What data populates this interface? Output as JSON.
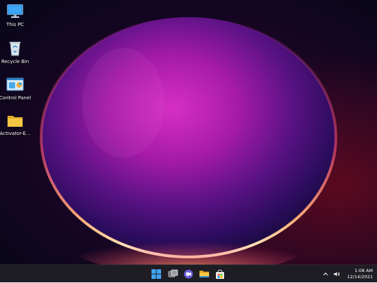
{
  "desktop": {
    "icons": [
      {
        "label": "This PC",
        "icon": "this-pc-icon"
      },
      {
        "label": "Recycle Bin",
        "icon": "recycle-bin-icon"
      },
      {
        "label": "Control Panel",
        "icon": "control-panel-icon"
      },
      {
        "label": "Activator-E...",
        "icon": "folder-icon"
      }
    ]
  },
  "taskbar": {
    "apps": [
      {
        "name": "Start",
        "icon": "windows-start-icon"
      },
      {
        "name": "Task View",
        "icon": "task-view-icon"
      },
      {
        "name": "Chat",
        "icon": "chat-icon"
      },
      {
        "name": "File Explorer",
        "icon": "file-explorer-icon"
      },
      {
        "name": "Microsoft Store",
        "icon": "store-icon"
      }
    ],
    "tray": {
      "time": "1:08 AM",
      "date": "12/14/2021"
    }
  },
  "colors": {
    "taskbar_bg": "#1f1d24",
    "accent_blue": "#3ea6f5",
    "folder_yellow": "#f6c744"
  }
}
